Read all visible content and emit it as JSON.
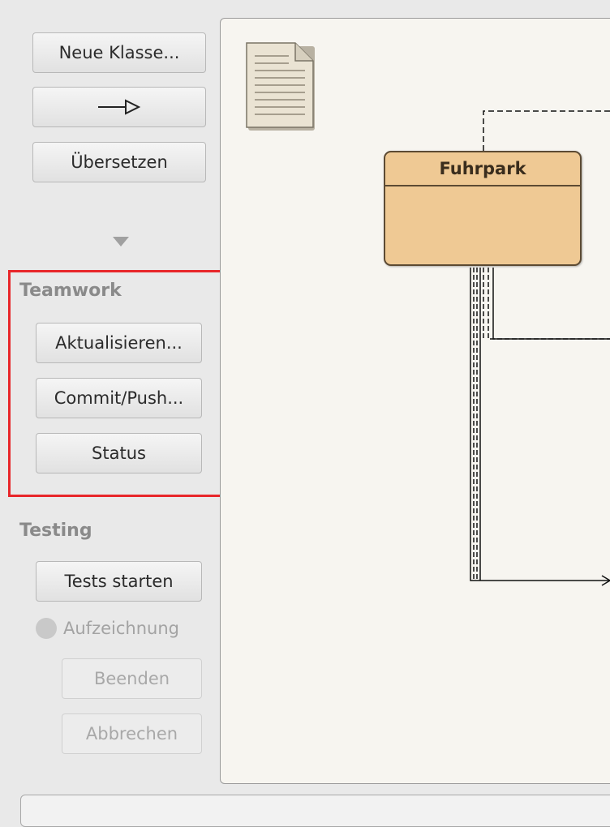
{
  "toolbar": {
    "new_class_label": "Neue Klasse...",
    "compile_label": "Übersetzen"
  },
  "teamwork": {
    "heading": "Teamwork",
    "update_label": "Aktualisieren...",
    "commit_label": "Commit/Push...",
    "status_label": "Status"
  },
  "testing": {
    "heading": "Testing",
    "run_tests_label": "Tests starten",
    "recording_label": "Aufzeichnung",
    "end_label": "Beenden",
    "cancel_label": "Abbrechen"
  },
  "diagram": {
    "class_name": "Fuhrpark"
  },
  "colors": {
    "highlight": "#e8262a",
    "class_fill": "#efc994",
    "canvas_bg": "#f7f5f0"
  }
}
